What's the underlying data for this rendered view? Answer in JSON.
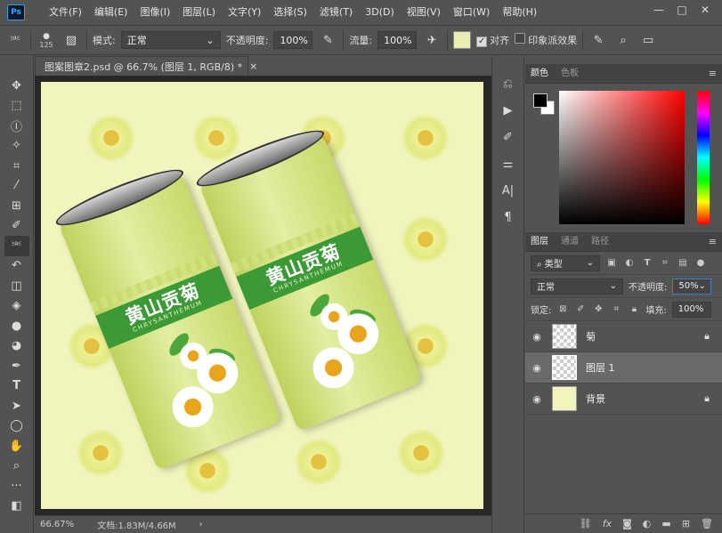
{
  "app": {
    "logo": "Ps"
  },
  "menu": [
    "文件(F)",
    "编辑(E)",
    "图像(I)",
    "图层(L)",
    "文字(Y)",
    "选择(S)",
    "滤镜(T)",
    "3D(D)",
    "视图(V)",
    "窗口(W)",
    "帮助(H)"
  ],
  "window_controls": {
    "minimize": "—",
    "maximize": "□",
    "close": "✕"
  },
  "options": {
    "brush_size": "125",
    "mode_label": "模式:",
    "mode_value": "正常",
    "opacity_label": "不透明度:",
    "opacity_value": "100%",
    "flow_label": "流量:",
    "flow_value": "100%",
    "align_label": "对齐",
    "align_checked": true,
    "impressionist_label": "印象派效果",
    "impressionist_checked": false
  },
  "document": {
    "tab_title": "图案图章2.psd @ 66.7% (图层 1, RGB/8) *",
    "tab_close": "×",
    "can_title": "黄山贡菊",
    "can_subtitle": "CHRYSANTHEMUM"
  },
  "status": {
    "zoom": "66.67%",
    "doc_info": "文档:1.83M/4.66M",
    "arrow": "›"
  },
  "color_panel": {
    "tabs": [
      "颜色",
      "色板"
    ],
    "fg_color": "#000000",
    "bg_color": "#ffffff"
  },
  "layers_panel": {
    "tabs": [
      "图层",
      "通道",
      "路径"
    ],
    "filter_label": "类型",
    "blend_mode": "正常",
    "opacity_label": "不透明度:",
    "opacity_value": "50%",
    "lock_label": "锁定:",
    "fill_label": "填充:",
    "fill_value": "100%",
    "layers": [
      {
        "name": "菊",
        "thumb": "checker",
        "selected": false,
        "locked": true
      },
      {
        "name": "图层 1",
        "thumb": "checker",
        "selected": true,
        "locked": false
      },
      {
        "name": "背景",
        "thumb": "yellow",
        "selected": false,
        "locked": true
      }
    ]
  },
  "accent_colors": {
    "canvas": "#f2f4be",
    "can_band": "#3c9a36",
    "ui_bg": "#535353"
  }
}
